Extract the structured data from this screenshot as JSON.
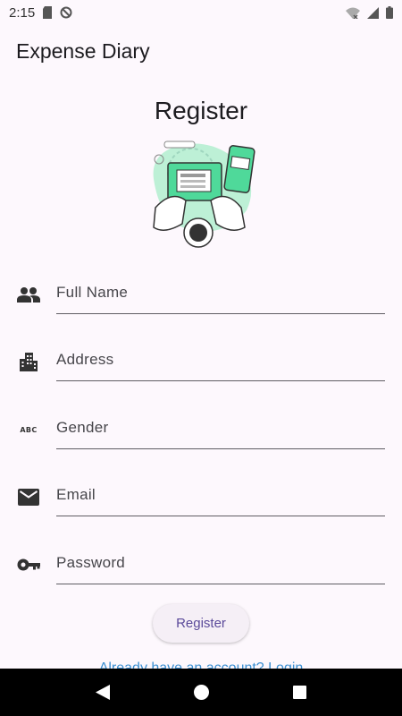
{
  "status_bar": {
    "time": "2:15"
  },
  "app_bar": {
    "title": "Expense Diary"
  },
  "page": {
    "heading": "Register"
  },
  "form": {
    "fields": [
      {
        "placeholder": "Full Name",
        "icon": "people-icon"
      },
      {
        "placeholder": "Address",
        "icon": "building-icon"
      },
      {
        "placeholder": "Gender",
        "icon": "abc-icon",
        "icon_text": "ABC"
      },
      {
        "placeholder": "Email",
        "icon": "mail-icon"
      },
      {
        "placeholder": "Password",
        "icon": "key-icon"
      }
    ],
    "register_label": "Register",
    "login_link": "Already have an account? Login"
  },
  "colors": {
    "background": "#fdf8fd",
    "button_text": "#5b4a9a",
    "link": "#3b8fd1",
    "illustration_accent": "#4fd99a"
  }
}
